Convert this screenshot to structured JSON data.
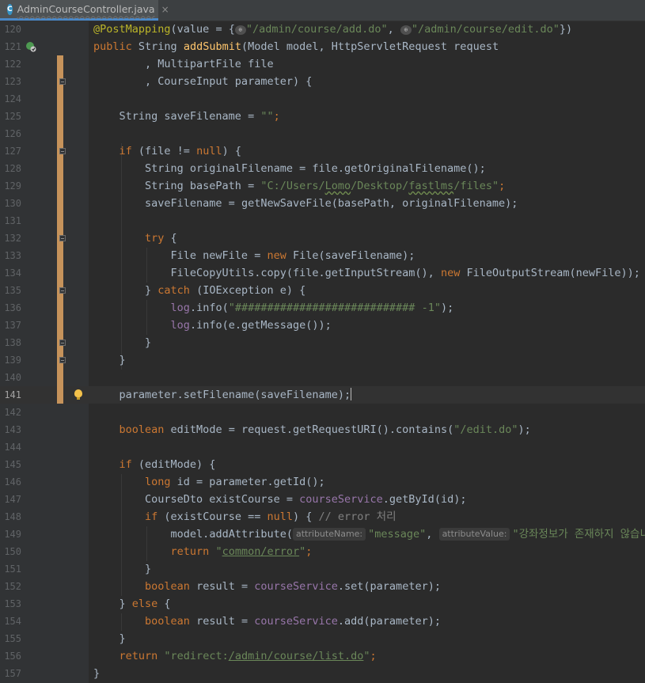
{
  "tab": {
    "icon": "class-file-icon",
    "icon_letter": "C",
    "filename": "AdminCourseController.java",
    "close": "×"
  },
  "colors": {
    "background": "#2b2b2b",
    "gutter": "#313335",
    "keyword": "#cc7832",
    "string": "#6a8759",
    "method": "#ffc66d",
    "field": "#9876aa",
    "annotation": "#bbb529",
    "vcs_change": "#c6935b"
  },
  "editor": {
    "current_line": 141,
    "hints": {
      "attribute_name": "attributeName:",
      "attribute_value": "attributeValue:"
    }
  },
  "lines": [
    {
      "n": "120"
    },
    {
      "n": "121"
    },
    {
      "n": "122"
    },
    {
      "n": "123"
    },
    {
      "n": "124"
    },
    {
      "n": "125"
    },
    {
      "n": "126"
    },
    {
      "n": "127"
    },
    {
      "n": "128"
    },
    {
      "n": "129"
    },
    {
      "n": "130"
    },
    {
      "n": "131"
    },
    {
      "n": "132"
    },
    {
      "n": "133"
    },
    {
      "n": "134"
    },
    {
      "n": "135"
    },
    {
      "n": "136"
    },
    {
      "n": "137"
    },
    {
      "n": "138"
    },
    {
      "n": "139"
    },
    {
      "n": "140"
    },
    {
      "n": "141"
    },
    {
      "n": "142"
    },
    {
      "n": "143"
    },
    {
      "n": "144"
    },
    {
      "n": "145"
    },
    {
      "n": "146"
    },
    {
      "n": "147"
    },
    {
      "n": "148"
    },
    {
      "n": "149"
    },
    {
      "n": "150"
    },
    {
      "n": "151"
    },
    {
      "n": "152"
    },
    {
      "n": "153"
    },
    {
      "n": "154"
    },
    {
      "n": "155"
    },
    {
      "n": "156"
    },
    {
      "n": "157"
    }
  ],
  "code": {
    "l120": {
      "a": "@PostMapping",
      "b": "(value = {",
      "c": "\"/admin/course/add.do\"",
      "d": ", ",
      "e": "\"/admin/course/edit.do\"",
      "f": "})"
    },
    "l121": {
      "a": "public ",
      "b": "String ",
      "c": "addSubmit",
      "d": "(Model model, HttpServletRequest request"
    },
    "l122": {
      "a": "        , MultipartFile file"
    },
    "l123": {
      "a": "        , CourseInput parameter) {"
    },
    "l125": {
      "a": "    String saveFilename = ",
      "b": "\"\"",
      "c": ";"
    },
    "l127": {
      "a": "    ",
      "b": "if ",
      "c": "(file != ",
      "d": "null",
      "e": ") {"
    },
    "l128": {
      "a": "        String originalFilename = file.",
      "b": "getOriginalFilename",
      "c": "();"
    },
    "l129": {
      "a": "        String basePath = ",
      "b": "\"C:/Users/",
      "c": "Lomo",
      "d": "/Desktop/",
      "e": "fastlms",
      "f": "/files\"",
      "g": ";"
    },
    "l130": {
      "a": "        saveFilename = ",
      "b": "getNewSaveFile",
      "c": "(basePath, originalFilename);"
    },
    "l132": {
      "a": "        ",
      "b": "try ",
      "c": "{"
    },
    "l133": {
      "a": "            File newFile = ",
      "b": "new ",
      "c": "File(saveFilename);"
    },
    "l134": {
      "a": "            FileCopyUtils.",
      "b": "copy",
      "c": "(file.",
      "d": "getInputStream",
      "e": "(), ",
      "f": "new ",
      "g": "FileOutputStream(newFile));"
    },
    "l135": {
      "a": "        } ",
      "b": "catch ",
      "c": "(IOException e) {"
    },
    "l136": {
      "a": "            ",
      "b": "log",
      "c": ".",
      "d": "info",
      "e": "(",
      "f": "\"############################ -1\"",
      "g": ");"
    },
    "l137": {
      "a": "            ",
      "b": "log",
      "c": ".",
      "d": "info",
      "e": "(e.",
      "f": "getMessage",
      "g": "());"
    },
    "l138": {
      "a": "        }"
    },
    "l139": {
      "a": "    }"
    },
    "l141": {
      "a": "    parameter.",
      "b": "setFilename",
      "c": "(saveFilename);"
    },
    "l143": {
      "a": "    ",
      "b": "boolean ",
      "c": "editMode = request.",
      "d": "getRequestURI",
      "e": "().",
      "f": "contains",
      "g": "(",
      "h": "\"/edit.do\"",
      "i": ");"
    },
    "l145": {
      "a": "    ",
      "b": "if ",
      "c": "(editMode) {"
    },
    "l146": {
      "a": "        ",
      "b": "long ",
      "c": "id = parameter.",
      "d": "getId",
      "e": "();"
    },
    "l147": {
      "a": "        CourseDto existCourse = ",
      "b": "courseService",
      "c": ".",
      "d": "getById",
      "e": "(id);"
    },
    "l148": {
      "a": "        ",
      "b": "if ",
      "c": "(existCourse == ",
      "d": "null",
      "e": ") { ",
      "f": "// error 처리"
    },
    "l149": {
      "a": "            model.",
      "b": "addAttribute",
      "c": "(",
      "d": "\"message\"",
      "e": ", ",
      "f": "\"강좌정보가 존재하지 않습니"
    },
    "l150": {
      "a": "            ",
      "b": "return ",
      "c": "\"",
      "d": "common/error",
      "e": "\"",
      "f": ";"
    },
    "l151": {
      "a": "        }"
    },
    "l152": {
      "a": "        ",
      "b": "boolean ",
      "c": "result = ",
      "d": "courseService",
      "e": ".",
      "f": "set",
      "g": "(parameter);"
    },
    "l153": {
      "a": "    } ",
      "b": "else ",
      "c": "{"
    },
    "l154": {
      "a": "        ",
      "b": "boolean ",
      "c": "result = ",
      "d": "courseService",
      "e": ".",
      "f": "add",
      "g": "(parameter);"
    },
    "l155": {
      "a": "    }"
    },
    "l156": {
      "a": "    ",
      "b": "return ",
      "c": "\"redirect:",
      "d": "/admin/course/list.do",
      "e": "\"",
      "f": ";"
    },
    "l157": {
      "a": "}"
    }
  }
}
